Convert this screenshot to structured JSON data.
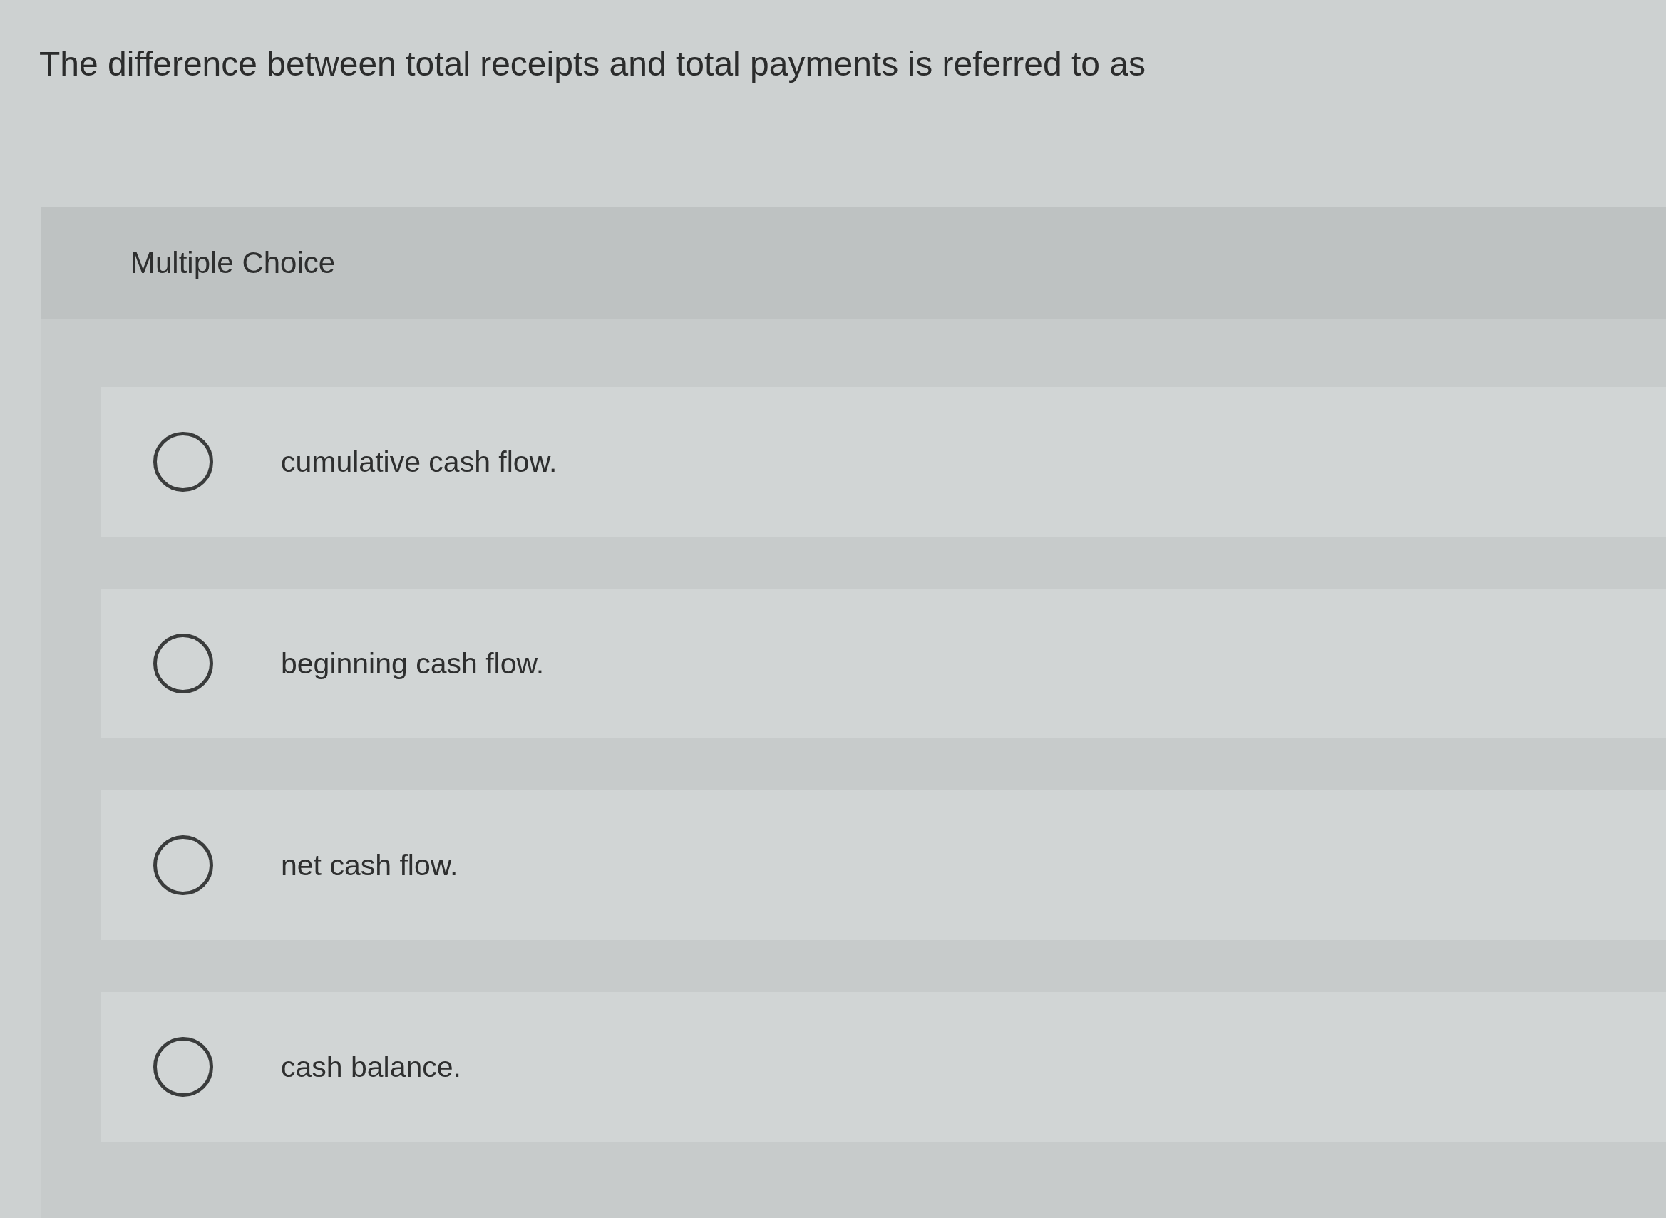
{
  "question": {
    "text": "The difference between total receipts and total payments is referred to as"
  },
  "panel": {
    "title": "Multiple Choice"
  },
  "options": [
    {
      "label": "cumulative cash flow.",
      "selected": false
    },
    {
      "label": "beginning cash flow.",
      "selected": false
    },
    {
      "label": "net cash flow.",
      "selected": false
    },
    {
      "label": "cash balance.",
      "selected": false
    }
  ]
}
